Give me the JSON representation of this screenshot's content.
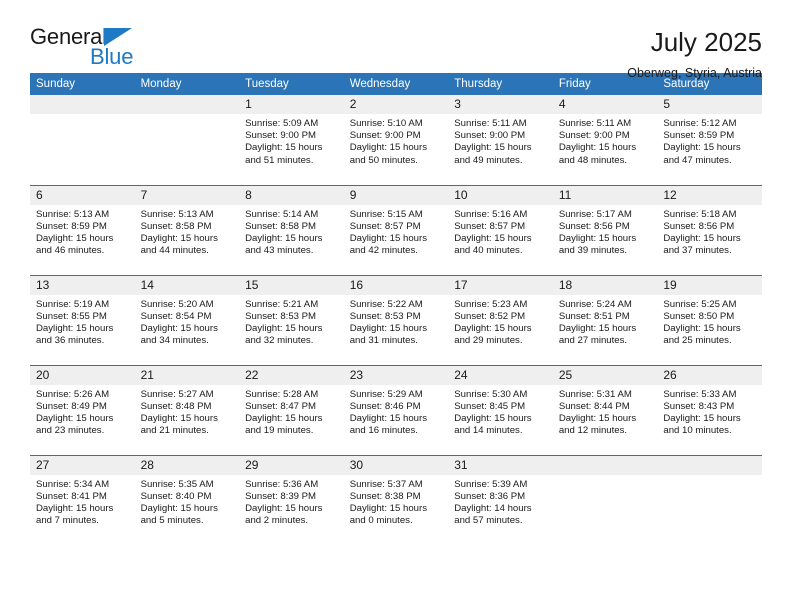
{
  "brand": {
    "name_top": "General",
    "name_bottom": "Blue",
    "triangle_color": "#1e7ac4"
  },
  "header": {
    "title": "July 2025",
    "subtitle": "Oberweg, Styria, Austria"
  },
  "theme": {
    "header_blue": "#2b74b8",
    "daynum_gray": "#efefef",
    "text": "#1a1a1a"
  },
  "weekday_headers": [
    "Sunday",
    "Monday",
    "Tuesday",
    "Wednesday",
    "Thursday",
    "Friday",
    "Saturday"
  ],
  "weeks": [
    [
      {
        "day": "",
        "sunrise": "",
        "sunset": "",
        "daylight": "",
        "empty": true
      },
      {
        "day": "",
        "sunrise": "",
        "sunset": "",
        "daylight": "",
        "empty": true
      },
      {
        "day": "1",
        "sunrise": "Sunrise: 5:09 AM",
        "sunset": "Sunset: 9:00 PM",
        "daylight": "Daylight: 15 hours and 51 minutes."
      },
      {
        "day": "2",
        "sunrise": "Sunrise: 5:10 AM",
        "sunset": "Sunset: 9:00 PM",
        "daylight": "Daylight: 15 hours and 50 minutes."
      },
      {
        "day": "3",
        "sunrise": "Sunrise: 5:11 AM",
        "sunset": "Sunset: 9:00 PM",
        "daylight": "Daylight: 15 hours and 49 minutes."
      },
      {
        "day": "4",
        "sunrise": "Sunrise: 5:11 AM",
        "sunset": "Sunset: 9:00 PM",
        "daylight": "Daylight: 15 hours and 48 minutes."
      },
      {
        "day": "5",
        "sunrise": "Sunrise: 5:12 AM",
        "sunset": "Sunset: 8:59 PM",
        "daylight": "Daylight: 15 hours and 47 minutes."
      }
    ],
    [
      {
        "day": "6",
        "sunrise": "Sunrise: 5:13 AM",
        "sunset": "Sunset: 8:59 PM",
        "daylight": "Daylight: 15 hours and 46 minutes."
      },
      {
        "day": "7",
        "sunrise": "Sunrise: 5:13 AM",
        "sunset": "Sunset: 8:58 PM",
        "daylight": "Daylight: 15 hours and 44 minutes."
      },
      {
        "day": "8",
        "sunrise": "Sunrise: 5:14 AM",
        "sunset": "Sunset: 8:58 PM",
        "daylight": "Daylight: 15 hours and 43 minutes."
      },
      {
        "day": "9",
        "sunrise": "Sunrise: 5:15 AM",
        "sunset": "Sunset: 8:57 PM",
        "daylight": "Daylight: 15 hours and 42 minutes."
      },
      {
        "day": "10",
        "sunrise": "Sunrise: 5:16 AM",
        "sunset": "Sunset: 8:57 PM",
        "daylight": "Daylight: 15 hours and 40 minutes."
      },
      {
        "day": "11",
        "sunrise": "Sunrise: 5:17 AM",
        "sunset": "Sunset: 8:56 PM",
        "daylight": "Daylight: 15 hours and 39 minutes."
      },
      {
        "day": "12",
        "sunrise": "Sunrise: 5:18 AM",
        "sunset": "Sunset: 8:56 PM",
        "daylight": "Daylight: 15 hours and 37 minutes."
      }
    ],
    [
      {
        "day": "13",
        "sunrise": "Sunrise: 5:19 AM",
        "sunset": "Sunset: 8:55 PM",
        "daylight": "Daylight: 15 hours and 36 minutes."
      },
      {
        "day": "14",
        "sunrise": "Sunrise: 5:20 AM",
        "sunset": "Sunset: 8:54 PM",
        "daylight": "Daylight: 15 hours and 34 minutes."
      },
      {
        "day": "15",
        "sunrise": "Sunrise: 5:21 AM",
        "sunset": "Sunset: 8:53 PM",
        "daylight": "Daylight: 15 hours and 32 minutes."
      },
      {
        "day": "16",
        "sunrise": "Sunrise: 5:22 AM",
        "sunset": "Sunset: 8:53 PM",
        "daylight": "Daylight: 15 hours and 31 minutes."
      },
      {
        "day": "17",
        "sunrise": "Sunrise: 5:23 AM",
        "sunset": "Sunset: 8:52 PM",
        "daylight": "Daylight: 15 hours and 29 minutes."
      },
      {
        "day": "18",
        "sunrise": "Sunrise: 5:24 AM",
        "sunset": "Sunset: 8:51 PM",
        "daylight": "Daylight: 15 hours and 27 minutes."
      },
      {
        "day": "19",
        "sunrise": "Sunrise: 5:25 AM",
        "sunset": "Sunset: 8:50 PM",
        "daylight": "Daylight: 15 hours and 25 minutes."
      }
    ],
    [
      {
        "day": "20",
        "sunrise": "Sunrise: 5:26 AM",
        "sunset": "Sunset: 8:49 PM",
        "daylight": "Daylight: 15 hours and 23 minutes."
      },
      {
        "day": "21",
        "sunrise": "Sunrise: 5:27 AM",
        "sunset": "Sunset: 8:48 PM",
        "daylight": "Daylight: 15 hours and 21 minutes."
      },
      {
        "day": "22",
        "sunrise": "Sunrise: 5:28 AM",
        "sunset": "Sunset: 8:47 PM",
        "daylight": "Daylight: 15 hours and 19 minutes."
      },
      {
        "day": "23",
        "sunrise": "Sunrise: 5:29 AM",
        "sunset": "Sunset: 8:46 PM",
        "daylight": "Daylight: 15 hours and 16 minutes."
      },
      {
        "day": "24",
        "sunrise": "Sunrise: 5:30 AM",
        "sunset": "Sunset: 8:45 PM",
        "daylight": "Daylight: 15 hours and 14 minutes."
      },
      {
        "day": "25",
        "sunrise": "Sunrise: 5:31 AM",
        "sunset": "Sunset: 8:44 PM",
        "daylight": "Daylight: 15 hours and 12 minutes."
      },
      {
        "day": "26",
        "sunrise": "Sunrise: 5:33 AM",
        "sunset": "Sunset: 8:43 PM",
        "daylight": "Daylight: 15 hours and 10 minutes."
      }
    ],
    [
      {
        "day": "27",
        "sunrise": "Sunrise: 5:34 AM",
        "sunset": "Sunset: 8:41 PM",
        "daylight": "Daylight: 15 hours and 7 minutes."
      },
      {
        "day": "28",
        "sunrise": "Sunrise: 5:35 AM",
        "sunset": "Sunset: 8:40 PM",
        "daylight": "Daylight: 15 hours and 5 minutes."
      },
      {
        "day": "29",
        "sunrise": "Sunrise: 5:36 AM",
        "sunset": "Sunset: 8:39 PM",
        "daylight": "Daylight: 15 hours and 2 minutes."
      },
      {
        "day": "30",
        "sunrise": "Sunrise: 5:37 AM",
        "sunset": "Sunset: 8:38 PM",
        "daylight": "Daylight: 15 hours and 0 minutes."
      },
      {
        "day": "31",
        "sunrise": "Sunrise: 5:39 AM",
        "sunset": "Sunset: 8:36 PM",
        "daylight": "Daylight: 14 hours and 57 minutes."
      },
      {
        "day": "",
        "sunrise": "",
        "sunset": "",
        "daylight": "",
        "empty": true
      },
      {
        "day": "",
        "sunrise": "",
        "sunset": "",
        "daylight": "",
        "empty": true
      }
    ]
  ]
}
